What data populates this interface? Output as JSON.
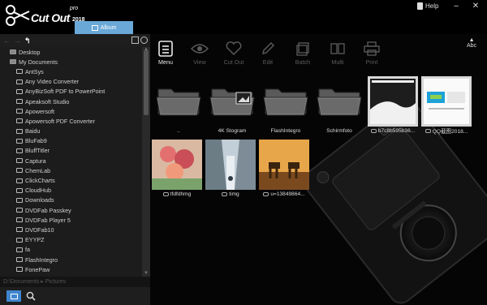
{
  "app": {
    "logo_name": "Cut Out",
    "logo_pro": "pro",
    "logo_year": "2018",
    "album_tab": "Album",
    "help_label": "Help"
  },
  "left_panel": {
    "tree": [
      {
        "label": "Desktop",
        "level": "root"
      },
      {
        "label": "My Documents",
        "level": "root"
      },
      {
        "label": "AntSys",
        "level": "child"
      },
      {
        "label": "Any Video Converter",
        "level": "child"
      },
      {
        "label": "AnyBizSoft PDF to PowerPoint",
        "level": "child"
      },
      {
        "label": "Apeaksoft Studio",
        "level": "child"
      },
      {
        "label": "Apowersoft",
        "level": "child"
      },
      {
        "label": "Apowersoft PDF Converter",
        "level": "child"
      },
      {
        "label": "Baidu",
        "level": "child"
      },
      {
        "label": "BluFab9",
        "level": "child"
      },
      {
        "label": "BluffTitler",
        "level": "child"
      },
      {
        "label": "Captura",
        "level": "child"
      },
      {
        "label": "ChemLab",
        "level": "child"
      },
      {
        "label": "ClickCharts",
        "level": "child"
      },
      {
        "label": "CloudHub",
        "level": "child"
      },
      {
        "label": "Downloads",
        "level": "child"
      },
      {
        "label": "DVDFab Passkey",
        "level": "child"
      },
      {
        "label": "DVDFab Player 5",
        "level": "child"
      },
      {
        "label": "DVDFab10",
        "level": "child"
      },
      {
        "label": "EYYPZ",
        "level": "child"
      },
      {
        "label": "fa",
        "level": "child"
      },
      {
        "label": "FlashIntegro",
        "level": "child"
      },
      {
        "label": "FonePaw",
        "level": "child"
      }
    ],
    "path": "D:\\Documents ▸ Pictures"
  },
  "toolbar": [
    {
      "label": "Menu",
      "icon": "menu-icon",
      "active": true
    },
    {
      "label": "View",
      "icon": "eye-icon",
      "active": false
    },
    {
      "label": "Cut Out",
      "icon": "heart-icon",
      "active": false
    },
    {
      "label": "Edit",
      "icon": "pencil-icon",
      "active": false
    },
    {
      "label": "Batch",
      "icon": "stack-icon",
      "active": false
    },
    {
      "label": "Multi",
      "icon": "pages-icon",
      "active": false
    },
    {
      "label": "Print",
      "icon": "printer-icon",
      "active": false
    }
  ],
  "sort_label": "Abc",
  "thumbnails": [
    {
      "label": "..",
      "kind": "folder"
    },
    {
      "label": "4K Stogram",
      "kind": "folder"
    },
    {
      "label": "FlashIntegro",
      "kind": "folder"
    },
    {
      "label": "Schirmfoto",
      "kind": "folder"
    },
    {
      "label": "b7c8b595b36...",
      "kind": "image"
    },
    {
      "label": "QQ截图2018...",
      "kind": "image"
    },
    {
      "label": "tfdfdhmg",
      "kind": "image"
    },
    {
      "label": "timg",
      "kind": "image"
    },
    {
      "label": "u=13849864...",
      "kind": "image"
    }
  ],
  "colors": {
    "accent": "#3f86cf",
    "album_tab": "#6aa8d8",
    "background": "#050505",
    "panel": "#1c1c1c"
  }
}
